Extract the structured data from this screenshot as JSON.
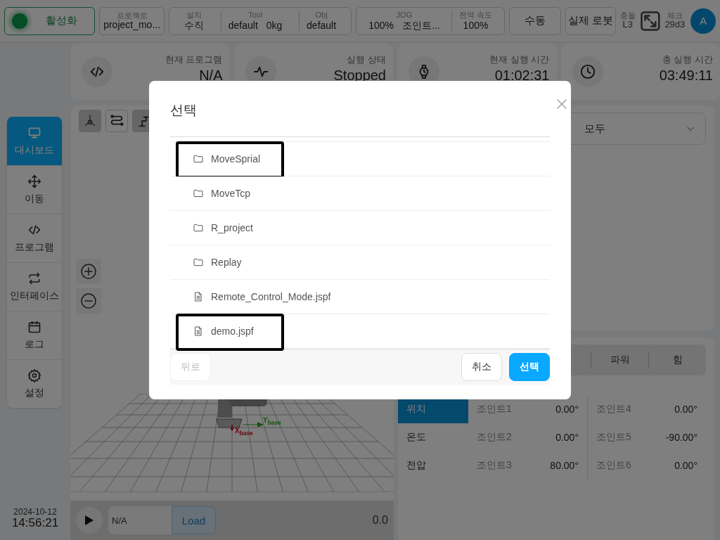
{
  "top_bar": {
    "activate_button": {
      "label": "활성화",
      "on": true
    },
    "project": {
      "label": "프로젝트",
      "value": "project_mo..."
    },
    "installation": [
      {
        "label": "설치",
        "value": "수직"
      },
      {
        "label": "Tool",
        "value": "default",
        "extra": "0kg"
      },
      {
        "label": "Obj",
        "value": "default"
      }
    ],
    "speed": [
      {
        "label": "JOG",
        "value": "100%",
        "extra": "조인트..."
      },
      {
        "label": "전역 속도",
        "value": "100%"
      }
    ],
    "mode_button": "수동",
    "robot_button": "실제 로봇",
    "collision": {
      "label": "충돌",
      "value": "L3"
    },
    "check": {
      "label": "체크",
      "value": "29d3"
    },
    "avatar": "A"
  },
  "stats": [
    {
      "label": "현재 프로그램",
      "value": "N/A"
    },
    {
      "label": "실행 상태",
      "value": "Stopped"
    },
    {
      "label": "현재 실행 시간",
      "value": "01:02:31"
    },
    {
      "label": "총 실행 시간",
      "value": "03:49:11"
    }
  ],
  "sidebar": {
    "items": [
      {
        "label": "대시보드",
        "selected": true
      },
      {
        "label": "이동",
        "selected": false
      },
      {
        "label": "프로그램",
        "selected": false
      },
      {
        "label": "인터페이스",
        "selected": false
      },
      {
        "label": "로그",
        "selected": false
      },
      {
        "label": "설정",
        "selected": false
      }
    ],
    "date": "2024-10-12",
    "time": "14:56:21"
  },
  "viewport": {
    "view_buttons": [
      {
        "selected": true
      },
      {
        "selected": false
      },
      {
        "selected": true
      }
    ],
    "axes": [
      {
        "label": "X$_{base}$"
      },
      {
        "label": "Y$_{base}$"
      }
    ]
  },
  "playback": {
    "program": "N/A",
    "load_button": "Load",
    "value": "0.0"
  },
  "filter": {
    "value": "모두"
  },
  "joint_panel": {
    "tabs": [
      "파워",
      "힘"
    ],
    "side_tabs": [
      {
        "label": "위치",
        "selected": true
      },
      {
        "label": "온도",
        "selected": false
      },
      {
        "label": "전압",
        "selected": false
      }
    ],
    "joints": [
      {
        "name": "조인트1",
        "value": "0.00°"
      },
      {
        "name": "조인트2",
        "value": "0.00°"
      },
      {
        "name": "조인트3",
        "value": "80.00°"
      },
      {
        "name": "조인트4",
        "value": "0.00°"
      },
      {
        "name": "조인트5",
        "value": "-90.00°"
      },
      {
        "name": "조인트6",
        "value": "0.00°"
      }
    ]
  },
  "modal": {
    "title": "선택",
    "items": [
      {
        "kind": "folder",
        "name": "MoveSprial",
        "highlighted": true
      },
      {
        "kind": "folder",
        "name": "MoveTcp",
        "highlighted": false
      },
      {
        "kind": "folder",
        "name": "R_project",
        "highlighted": false
      },
      {
        "kind": "folder",
        "name": "Replay",
        "highlighted": false
      },
      {
        "kind": "file",
        "name": "Remote_Control_Mode.jspf",
        "highlighted": false
      },
      {
        "kind": "file",
        "name": "demo.jspf",
        "highlighted": true
      }
    ],
    "back_button": {
      "label": "뒤로",
      "disabled": true
    },
    "cancel_button": "취소",
    "confirm_button": "선택"
  }
}
